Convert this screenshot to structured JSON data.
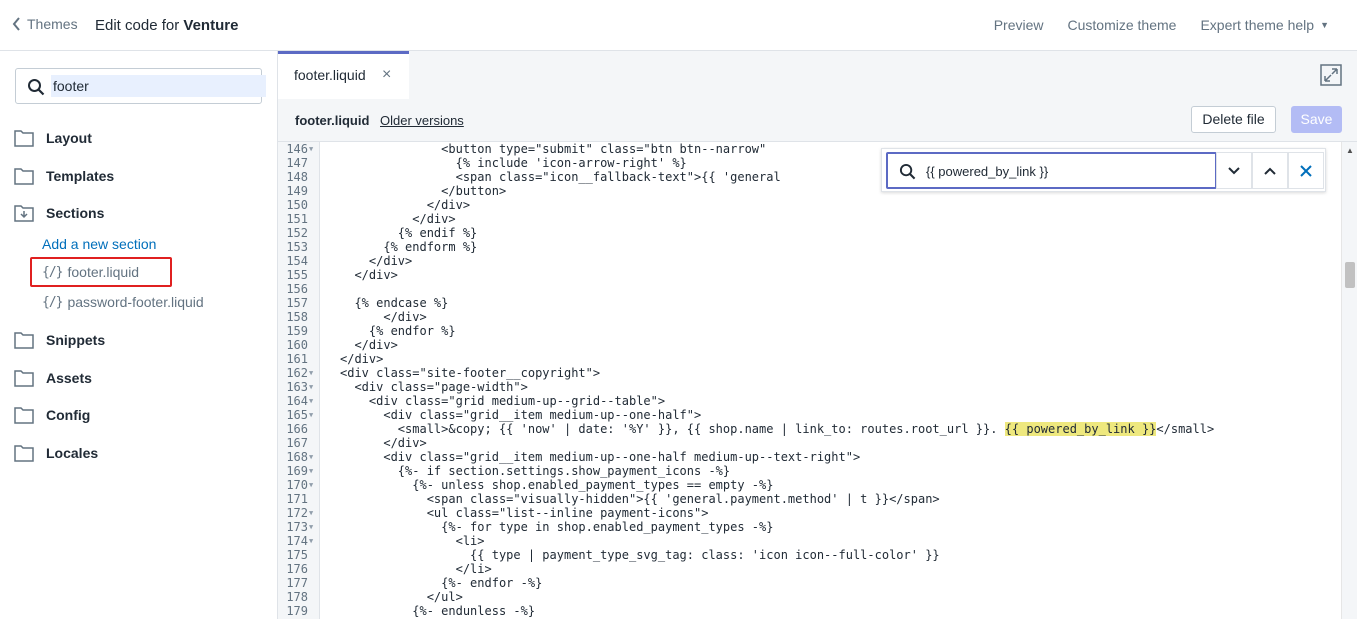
{
  "topbar": {
    "back_label": "Themes",
    "title_prefix": "Edit code for ",
    "theme_name": "Venture",
    "nav": {
      "preview": "Preview",
      "customize": "Customize theme",
      "help": "Expert theme help"
    }
  },
  "sidebar": {
    "search_value": "footer",
    "folders": {
      "layout": "Layout",
      "templates": "Templates",
      "sections": "Sections",
      "snippets": "Snippets",
      "assets": "Assets",
      "config": "Config",
      "locales": "Locales"
    },
    "add_section": "Add a new section",
    "files": [
      {
        "icon": "{/}",
        "name": "footer.liquid"
      },
      {
        "icon": "{/}",
        "name": "password-footer.liquid"
      }
    ]
  },
  "tab": {
    "label": "footer.liquid",
    "close": "×"
  },
  "filebar": {
    "name": "footer.liquid",
    "older": "Older versions",
    "delete": "Delete file",
    "save": "Save"
  },
  "find": {
    "query": "{{ powered_by_link }}"
  },
  "code_lines": [
    {
      "n": "146",
      "fold": true,
      "text": "              <button type=\"submit\" class=\"btn btn--narrow\" "
    },
    {
      "n": "147",
      "fold": false,
      "text": "                {% include 'icon-arrow-right' %}"
    },
    {
      "n": "148",
      "fold": false,
      "text": "                <span class=\"icon__fallback-text\">{{ 'general"
    },
    {
      "n": "149",
      "fold": false,
      "text": "              </button>"
    },
    {
      "n": "150",
      "fold": false,
      "text": "            </div>"
    },
    {
      "n": "151",
      "fold": false,
      "text": "          </div>"
    },
    {
      "n": "152",
      "fold": false,
      "text": "        {% endif %}"
    },
    {
      "n": "153",
      "fold": false,
      "text": "      {% endform %}"
    },
    {
      "n": "154",
      "fold": false,
      "text": "    </div>"
    },
    {
      "n": "155",
      "fold": false,
      "text": "  </div>"
    },
    {
      "n": "156",
      "fold": false,
      "text": ""
    },
    {
      "n": "157",
      "fold": false,
      "text": "  {% endcase %}"
    },
    {
      "n": "158",
      "fold": false,
      "text": "      </div>"
    },
    {
      "n": "159",
      "fold": false,
      "text": "    {% endfor %}"
    },
    {
      "n": "160",
      "fold": false,
      "text": "  </div>"
    },
    {
      "n": "161",
      "fold": false,
      "text": "</div>"
    },
    {
      "n": "162",
      "fold": true,
      "text": "<div class=\"site-footer__copyright\">"
    },
    {
      "n": "163",
      "fold": true,
      "text": "  <div class=\"page-width\">"
    },
    {
      "n": "164",
      "fold": true,
      "text": "    <div class=\"grid medium-up--grid--table\">"
    },
    {
      "n": "165",
      "fold": true,
      "text": "      <div class=\"grid__item medium-up--one-half\">"
    },
    {
      "n": "166",
      "fold": false,
      "text": "        <small>&copy; {{ 'now' | date: '%Y' }}, {{ shop.name | link_to: routes.root_url }}. "
    },
    {
      "n": "167",
      "fold": false,
      "text": "      </div>"
    },
    {
      "n": "168",
      "fold": true,
      "text": "      <div class=\"grid__item medium-up--one-half medium-up--text-right\">"
    },
    {
      "n": "169",
      "fold": true,
      "text": "        {%- if section.settings.show_payment_icons -%}"
    },
    {
      "n": "170",
      "fold": true,
      "text": "          {%- unless shop.enabled_payment_types == empty -%}"
    },
    {
      "n": "171",
      "fold": false,
      "text": "            <span class=\"visually-hidden\">{{ 'general.payment.method' | t }}</span>"
    },
    {
      "n": "172",
      "fold": true,
      "text": "            <ul class=\"list--inline payment-icons\">"
    },
    {
      "n": "173",
      "fold": true,
      "text": "              {%- for type in shop.enabled_payment_types -%}"
    },
    {
      "n": "174",
      "fold": true,
      "text": "                <li>"
    },
    {
      "n": "175",
      "fold": false,
      "text": "                  {{ type | payment_type_svg_tag: class: 'icon icon--full-color' }}"
    },
    {
      "n": "176",
      "fold": false,
      "text": "                </li>"
    },
    {
      "n": "177",
      "fold": false,
      "text": "              {%- endfor -%}"
    },
    {
      "n": "178",
      "fold": false,
      "text": "            </ul>"
    },
    {
      "n": "179",
      "fold": false,
      "text": "          {%- endunless -%}"
    }
  ],
  "line166_highlight": "{{ powered_by_link }}",
  "line166_tail": "</small>",
  "colors": {
    "accent": "#5c6ac4",
    "link": "#006fbb",
    "highlight": "#eee87e",
    "annotation_box": "#e02020"
  }
}
